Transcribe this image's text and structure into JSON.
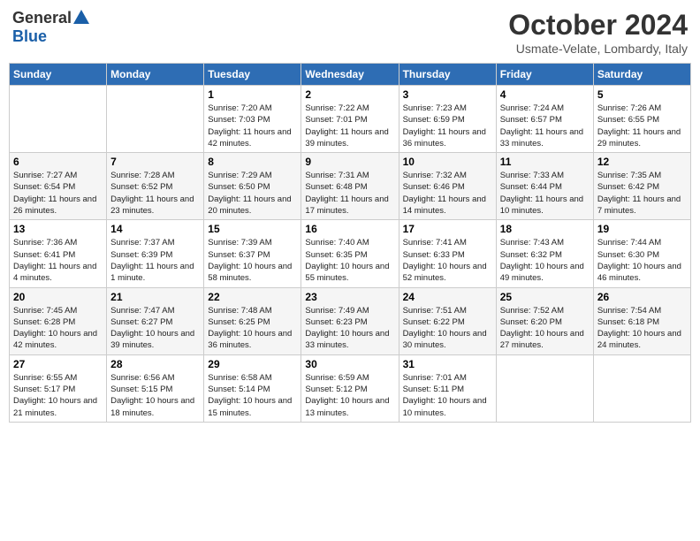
{
  "header": {
    "logo_general": "General",
    "logo_blue": "Blue",
    "month": "October 2024",
    "location": "Usmate-Velate, Lombardy, Italy"
  },
  "days_of_week": [
    "Sunday",
    "Monday",
    "Tuesday",
    "Wednesday",
    "Thursday",
    "Friday",
    "Saturday"
  ],
  "weeks": [
    [
      {
        "day": "",
        "sunrise": "",
        "sunset": "",
        "daylight": ""
      },
      {
        "day": "",
        "sunrise": "",
        "sunset": "",
        "daylight": ""
      },
      {
        "day": "1",
        "sunrise": "Sunrise: 7:20 AM",
        "sunset": "Sunset: 7:03 PM",
        "daylight": "Daylight: 11 hours and 42 minutes."
      },
      {
        "day": "2",
        "sunrise": "Sunrise: 7:22 AM",
        "sunset": "Sunset: 7:01 PM",
        "daylight": "Daylight: 11 hours and 39 minutes."
      },
      {
        "day": "3",
        "sunrise": "Sunrise: 7:23 AM",
        "sunset": "Sunset: 6:59 PM",
        "daylight": "Daylight: 11 hours and 36 minutes."
      },
      {
        "day": "4",
        "sunrise": "Sunrise: 7:24 AM",
        "sunset": "Sunset: 6:57 PM",
        "daylight": "Daylight: 11 hours and 33 minutes."
      },
      {
        "day": "5",
        "sunrise": "Sunrise: 7:26 AM",
        "sunset": "Sunset: 6:55 PM",
        "daylight": "Daylight: 11 hours and 29 minutes."
      }
    ],
    [
      {
        "day": "6",
        "sunrise": "Sunrise: 7:27 AM",
        "sunset": "Sunset: 6:54 PM",
        "daylight": "Daylight: 11 hours and 26 minutes."
      },
      {
        "day": "7",
        "sunrise": "Sunrise: 7:28 AM",
        "sunset": "Sunset: 6:52 PM",
        "daylight": "Daylight: 11 hours and 23 minutes."
      },
      {
        "day": "8",
        "sunrise": "Sunrise: 7:29 AM",
        "sunset": "Sunset: 6:50 PM",
        "daylight": "Daylight: 11 hours and 20 minutes."
      },
      {
        "day": "9",
        "sunrise": "Sunrise: 7:31 AM",
        "sunset": "Sunset: 6:48 PM",
        "daylight": "Daylight: 11 hours and 17 minutes."
      },
      {
        "day": "10",
        "sunrise": "Sunrise: 7:32 AM",
        "sunset": "Sunset: 6:46 PM",
        "daylight": "Daylight: 11 hours and 14 minutes."
      },
      {
        "day": "11",
        "sunrise": "Sunrise: 7:33 AM",
        "sunset": "Sunset: 6:44 PM",
        "daylight": "Daylight: 11 hours and 10 minutes."
      },
      {
        "day": "12",
        "sunrise": "Sunrise: 7:35 AM",
        "sunset": "Sunset: 6:42 PM",
        "daylight": "Daylight: 11 hours and 7 minutes."
      }
    ],
    [
      {
        "day": "13",
        "sunrise": "Sunrise: 7:36 AM",
        "sunset": "Sunset: 6:41 PM",
        "daylight": "Daylight: 11 hours and 4 minutes."
      },
      {
        "day": "14",
        "sunrise": "Sunrise: 7:37 AM",
        "sunset": "Sunset: 6:39 PM",
        "daylight": "Daylight: 11 hours and 1 minute."
      },
      {
        "day": "15",
        "sunrise": "Sunrise: 7:39 AM",
        "sunset": "Sunset: 6:37 PM",
        "daylight": "Daylight: 10 hours and 58 minutes."
      },
      {
        "day": "16",
        "sunrise": "Sunrise: 7:40 AM",
        "sunset": "Sunset: 6:35 PM",
        "daylight": "Daylight: 10 hours and 55 minutes."
      },
      {
        "day": "17",
        "sunrise": "Sunrise: 7:41 AM",
        "sunset": "Sunset: 6:33 PM",
        "daylight": "Daylight: 10 hours and 52 minutes."
      },
      {
        "day": "18",
        "sunrise": "Sunrise: 7:43 AM",
        "sunset": "Sunset: 6:32 PM",
        "daylight": "Daylight: 10 hours and 49 minutes."
      },
      {
        "day": "19",
        "sunrise": "Sunrise: 7:44 AM",
        "sunset": "Sunset: 6:30 PM",
        "daylight": "Daylight: 10 hours and 46 minutes."
      }
    ],
    [
      {
        "day": "20",
        "sunrise": "Sunrise: 7:45 AM",
        "sunset": "Sunset: 6:28 PM",
        "daylight": "Daylight: 10 hours and 42 minutes."
      },
      {
        "day": "21",
        "sunrise": "Sunrise: 7:47 AM",
        "sunset": "Sunset: 6:27 PM",
        "daylight": "Daylight: 10 hours and 39 minutes."
      },
      {
        "day": "22",
        "sunrise": "Sunrise: 7:48 AM",
        "sunset": "Sunset: 6:25 PM",
        "daylight": "Daylight: 10 hours and 36 minutes."
      },
      {
        "day": "23",
        "sunrise": "Sunrise: 7:49 AM",
        "sunset": "Sunset: 6:23 PM",
        "daylight": "Daylight: 10 hours and 33 minutes."
      },
      {
        "day": "24",
        "sunrise": "Sunrise: 7:51 AM",
        "sunset": "Sunset: 6:22 PM",
        "daylight": "Daylight: 10 hours and 30 minutes."
      },
      {
        "day": "25",
        "sunrise": "Sunrise: 7:52 AM",
        "sunset": "Sunset: 6:20 PM",
        "daylight": "Daylight: 10 hours and 27 minutes."
      },
      {
        "day": "26",
        "sunrise": "Sunrise: 7:54 AM",
        "sunset": "Sunset: 6:18 PM",
        "daylight": "Daylight: 10 hours and 24 minutes."
      }
    ],
    [
      {
        "day": "27",
        "sunrise": "Sunrise: 6:55 AM",
        "sunset": "Sunset: 5:17 PM",
        "daylight": "Daylight: 10 hours and 21 minutes."
      },
      {
        "day": "28",
        "sunrise": "Sunrise: 6:56 AM",
        "sunset": "Sunset: 5:15 PM",
        "daylight": "Daylight: 10 hours and 18 minutes."
      },
      {
        "day": "29",
        "sunrise": "Sunrise: 6:58 AM",
        "sunset": "Sunset: 5:14 PM",
        "daylight": "Daylight: 10 hours and 15 minutes."
      },
      {
        "day": "30",
        "sunrise": "Sunrise: 6:59 AM",
        "sunset": "Sunset: 5:12 PM",
        "daylight": "Daylight: 10 hours and 13 minutes."
      },
      {
        "day": "31",
        "sunrise": "Sunrise: 7:01 AM",
        "sunset": "Sunset: 5:11 PM",
        "daylight": "Daylight: 10 hours and 10 minutes."
      },
      {
        "day": "",
        "sunrise": "",
        "sunset": "",
        "daylight": ""
      },
      {
        "day": "",
        "sunrise": "",
        "sunset": "",
        "daylight": ""
      }
    ]
  ]
}
